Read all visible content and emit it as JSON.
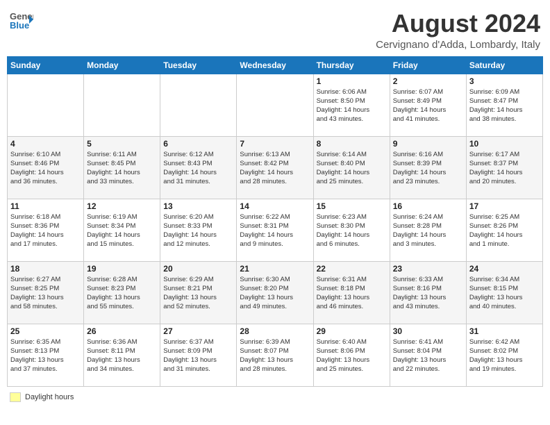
{
  "header": {
    "logo_general": "General",
    "logo_blue": "Blue",
    "month_title": "August 2024",
    "location": "Cervignano d'Adda, Lombardy, Italy"
  },
  "days_of_week": [
    "Sunday",
    "Monday",
    "Tuesday",
    "Wednesday",
    "Thursday",
    "Friday",
    "Saturday"
  ],
  "weeks": [
    [
      {
        "day": "",
        "info": ""
      },
      {
        "day": "",
        "info": ""
      },
      {
        "day": "",
        "info": ""
      },
      {
        "day": "",
        "info": ""
      },
      {
        "day": "1",
        "info": "Sunrise: 6:06 AM\nSunset: 8:50 PM\nDaylight: 14 hours\nand 43 minutes."
      },
      {
        "day": "2",
        "info": "Sunrise: 6:07 AM\nSunset: 8:49 PM\nDaylight: 14 hours\nand 41 minutes."
      },
      {
        "day": "3",
        "info": "Sunrise: 6:09 AM\nSunset: 8:47 PM\nDaylight: 14 hours\nand 38 minutes."
      }
    ],
    [
      {
        "day": "4",
        "info": "Sunrise: 6:10 AM\nSunset: 8:46 PM\nDaylight: 14 hours\nand 36 minutes."
      },
      {
        "day": "5",
        "info": "Sunrise: 6:11 AM\nSunset: 8:45 PM\nDaylight: 14 hours\nand 33 minutes."
      },
      {
        "day": "6",
        "info": "Sunrise: 6:12 AM\nSunset: 8:43 PM\nDaylight: 14 hours\nand 31 minutes."
      },
      {
        "day": "7",
        "info": "Sunrise: 6:13 AM\nSunset: 8:42 PM\nDaylight: 14 hours\nand 28 minutes."
      },
      {
        "day": "8",
        "info": "Sunrise: 6:14 AM\nSunset: 8:40 PM\nDaylight: 14 hours\nand 25 minutes."
      },
      {
        "day": "9",
        "info": "Sunrise: 6:16 AM\nSunset: 8:39 PM\nDaylight: 14 hours\nand 23 minutes."
      },
      {
        "day": "10",
        "info": "Sunrise: 6:17 AM\nSunset: 8:37 PM\nDaylight: 14 hours\nand 20 minutes."
      }
    ],
    [
      {
        "day": "11",
        "info": "Sunrise: 6:18 AM\nSunset: 8:36 PM\nDaylight: 14 hours\nand 17 minutes."
      },
      {
        "day": "12",
        "info": "Sunrise: 6:19 AM\nSunset: 8:34 PM\nDaylight: 14 hours\nand 15 minutes."
      },
      {
        "day": "13",
        "info": "Sunrise: 6:20 AM\nSunset: 8:33 PM\nDaylight: 14 hours\nand 12 minutes."
      },
      {
        "day": "14",
        "info": "Sunrise: 6:22 AM\nSunset: 8:31 PM\nDaylight: 14 hours\nand 9 minutes."
      },
      {
        "day": "15",
        "info": "Sunrise: 6:23 AM\nSunset: 8:30 PM\nDaylight: 14 hours\nand 6 minutes."
      },
      {
        "day": "16",
        "info": "Sunrise: 6:24 AM\nSunset: 8:28 PM\nDaylight: 14 hours\nand 3 minutes."
      },
      {
        "day": "17",
        "info": "Sunrise: 6:25 AM\nSunset: 8:26 PM\nDaylight: 14 hours\nand 1 minute."
      }
    ],
    [
      {
        "day": "18",
        "info": "Sunrise: 6:27 AM\nSunset: 8:25 PM\nDaylight: 13 hours\nand 58 minutes."
      },
      {
        "day": "19",
        "info": "Sunrise: 6:28 AM\nSunset: 8:23 PM\nDaylight: 13 hours\nand 55 minutes."
      },
      {
        "day": "20",
        "info": "Sunrise: 6:29 AM\nSunset: 8:21 PM\nDaylight: 13 hours\nand 52 minutes."
      },
      {
        "day": "21",
        "info": "Sunrise: 6:30 AM\nSunset: 8:20 PM\nDaylight: 13 hours\nand 49 minutes."
      },
      {
        "day": "22",
        "info": "Sunrise: 6:31 AM\nSunset: 8:18 PM\nDaylight: 13 hours\nand 46 minutes."
      },
      {
        "day": "23",
        "info": "Sunrise: 6:33 AM\nSunset: 8:16 PM\nDaylight: 13 hours\nand 43 minutes."
      },
      {
        "day": "24",
        "info": "Sunrise: 6:34 AM\nSunset: 8:15 PM\nDaylight: 13 hours\nand 40 minutes."
      }
    ],
    [
      {
        "day": "25",
        "info": "Sunrise: 6:35 AM\nSunset: 8:13 PM\nDaylight: 13 hours\nand 37 minutes."
      },
      {
        "day": "26",
        "info": "Sunrise: 6:36 AM\nSunset: 8:11 PM\nDaylight: 13 hours\nand 34 minutes."
      },
      {
        "day": "27",
        "info": "Sunrise: 6:37 AM\nSunset: 8:09 PM\nDaylight: 13 hours\nand 31 minutes."
      },
      {
        "day": "28",
        "info": "Sunrise: 6:39 AM\nSunset: 8:07 PM\nDaylight: 13 hours\nand 28 minutes."
      },
      {
        "day": "29",
        "info": "Sunrise: 6:40 AM\nSunset: 8:06 PM\nDaylight: 13 hours\nand 25 minutes."
      },
      {
        "day": "30",
        "info": "Sunrise: 6:41 AM\nSunset: 8:04 PM\nDaylight: 13 hours\nand 22 minutes."
      },
      {
        "day": "31",
        "info": "Sunrise: 6:42 AM\nSunset: 8:02 PM\nDaylight: 13 hours\nand 19 minutes."
      }
    ]
  ],
  "legend": {
    "daylight_label": "Daylight hours"
  }
}
